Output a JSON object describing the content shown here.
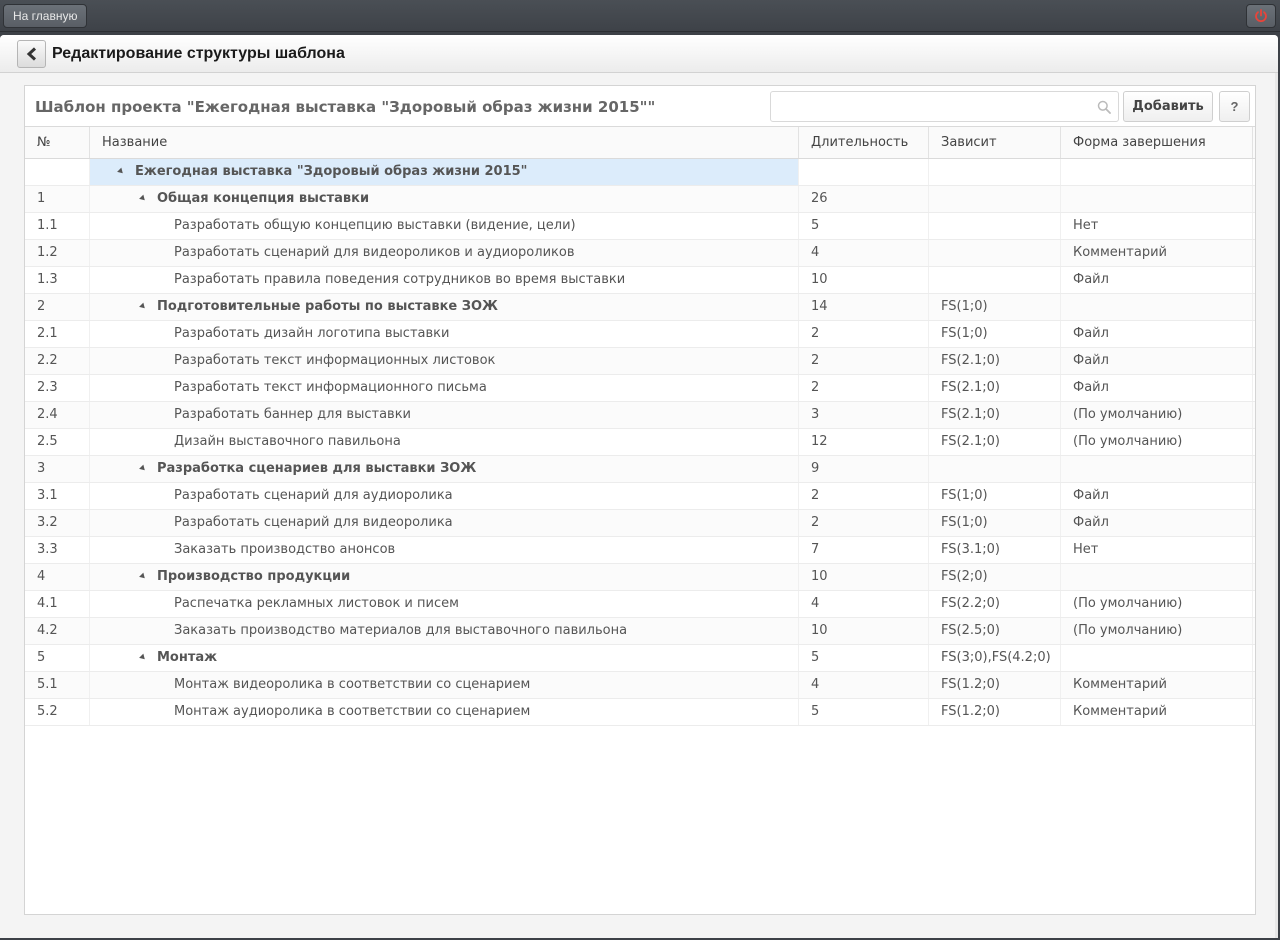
{
  "topbar": {
    "home_label": "На главную",
    "power_icon": "power-icon"
  },
  "header": {
    "title": "Редактирование структуры шаблона"
  },
  "panel": {
    "title": "Шаблон проекта \"Ежегодная выставка \"Здоровый образ жизни 2015\"\"",
    "search_placeholder": "",
    "add_label": "Добавить",
    "help_label": "?"
  },
  "columns": [
    "№",
    "Название",
    "Длительность",
    "Зависит",
    "Форма завершения"
  ],
  "rows": [
    {
      "num": "",
      "name": "Ежегодная выставка \"Здоровый образ жизни 2015\"",
      "duration": "",
      "depends": "",
      "form": "",
      "level": 0
    },
    {
      "num": "1",
      "name": "Общая концепция выставки",
      "duration": "26",
      "depends": "",
      "form": "",
      "level": 1
    },
    {
      "num": "1.1",
      "name": "Разработать общую концепцию выставки (видение, цели)",
      "duration": "5",
      "depends": "",
      "form": "Нет",
      "level": 2
    },
    {
      "num": "1.2",
      "name": "Разработать сценарий для видеороликов и аудиороликов",
      "duration": "4",
      "depends": "",
      "form": "Комментарий",
      "level": 2
    },
    {
      "num": "1.3",
      "name": "Разработать правила поведения сотрудников во время выставки",
      "duration": "10",
      "depends": "",
      "form": "Файл",
      "level": 2
    },
    {
      "num": "2",
      "name": "Подготовительные работы по выставке ЗОЖ",
      "duration": "14",
      "depends": "FS(1;0)",
      "form": "",
      "level": 1
    },
    {
      "num": "2.1",
      "name": "Разработать дизайн логотипа выставки",
      "duration": "2",
      "depends": "FS(1;0)",
      "form": "Файл",
      "level": 2
    },
    {
      "num": "2.2",
      "name": "Разработать текст информационных листовок",
      "duration": "2",
      "depends": "FS(2.1;0)",
      "form": "Файл",
      "level": 2
    },
    {
      "num": "2.3",
      "name": "Разработать текст информационного письма",
      "duration": "2",
      "depends": "FS(2.1;0)",
      "form": "Файл",
      "level": 2
    },
    {
      "num": "2.4",
      "name": "Разработать баннер для выставки",
      "duration": "3",
      "depends": "FS(2.1;0)",
      "form": "(По умолчанию)",
      "level": 2
    },
    {
      "num": "2.5",
      "name": "Дизайн выставочного павильона",
      "duration": "12",
      "depends": "FS(2.1;0)",
      "form": "(По умолчанию)",
      "level": 2
    },
    {
      "num": "3",
      "name": "Разработка сценариев для выставки ЗОЖ",
      "duration": "9",
      "depends": "",
      "form": "",
      "level": 1
    },
    {
      "num": "3.1",
      "name": "Разработать сценарий для аудиоролика",
      "duration": "2",
      "depends": "FS(1;0)",
      "form": "Файл",
      "level": 2
    },
    {
      "num": "3.2",
      "name": "Разработать сценарий для видеоролика",
      "duration": "2",
      "depends": "FS(1;0)",
      "form": "Файл",
      "level": 2
    },
    {
      "num": "3.3",
      "name": "Заказать производство анонсов",
      "duration": "7",
      "depends": "FS(3.1;0)",
      "form": "Нет",
      "level": 2
    },
    {
      "num": "4",
      "name": "Производство продукции",
      "duration": "10",
      "depends": "FS(2;0)",
      "form": "",
      "level": 1
    },
    {
      "num": "4.1",
      "name": "Распечатка рекламных листовок и писем",
      "duration": "4",
      "depends": "FS(2.2;0)",
      "form": "(По умолчанию)",
      "level": 2
    },
    {
      "num": "4.2",
      "name": "Заказать производство материалов для выставочного павильона",
      "duration": "10",
      "depends": "FS(2.5;0)",
      "form": "(По умолчанию)",
      "level": 2
    },
    {
      "num": "5",
      "name": "Монтаж",
      "duration": "5",
      "depends": "FS(3;0),FS(4.2;0)",
      "form": "",
      "level": 1
    },
    {
      "num": "5.1",
      "name": "Монтаж видеоролика в соответствии со сценарием",
      "duration": "4",
      "depends": "FS(1.2;0)",
      "form": "Комментарий",
      "level": 2
    },
    {
      "num": "5.2",
      "name": "Монтаж аудиоролика в соответствии со сценарием",
      "duration": "5",
      "depends": "FS(1.2;0)",
      "form": "Комментарий",
      "level": 2
    }
  ]
}
